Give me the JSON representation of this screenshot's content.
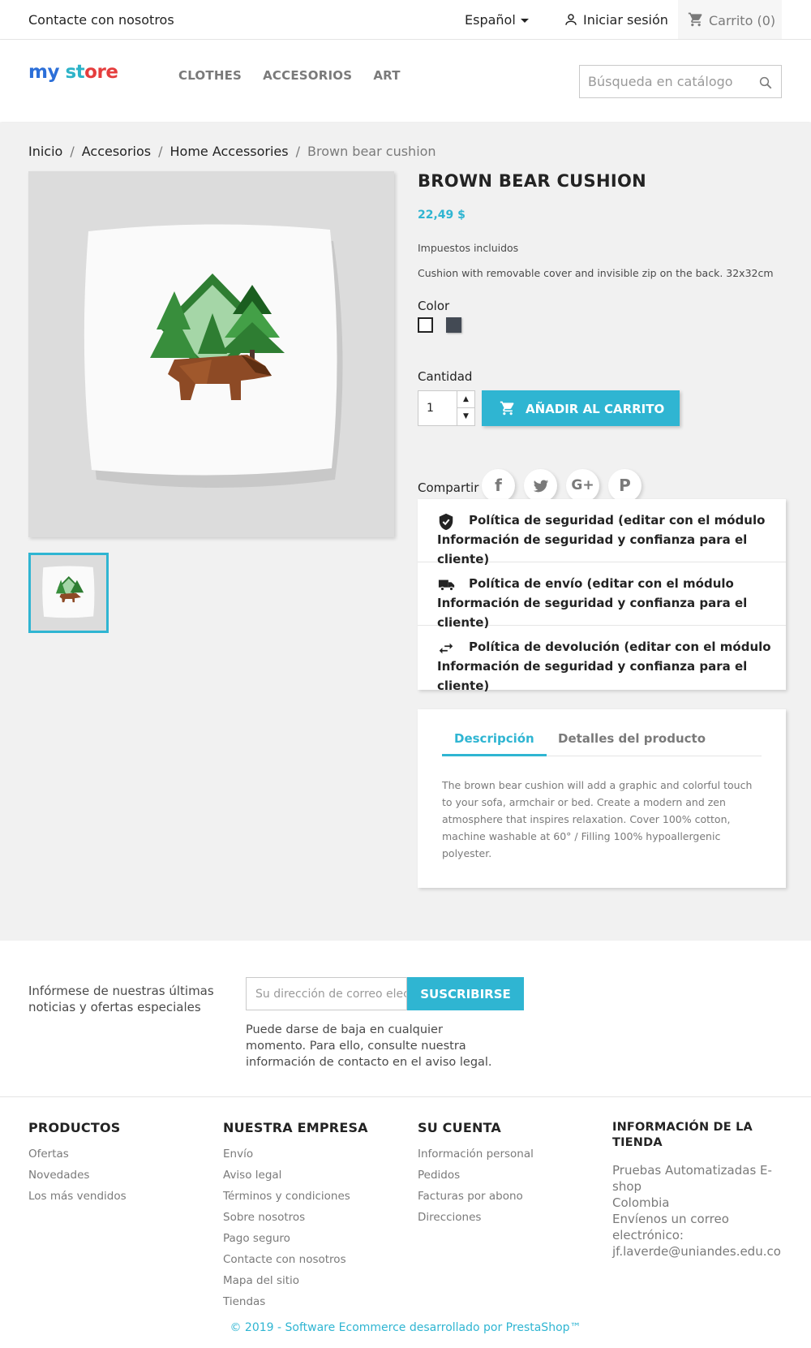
{
  "topbar": {
    "contact": "Contacte con nosotros",
    "language": "Español",
    "login": "Iniciar sesión",
    "cart": "Carrito (0)"
  },
  "header": {
    "logo_parts": [
      "my",
      " ",
      "st",
      "ore"
    ],
    "nav": [
      "CLOTHES",
      "ACCESORIOS",
      "ART"
    ],
    "search_placeholder": "Búsqueda en catálogo"
  },
  "breadcrumb": [
    "Inicio",
    "Accesorios",
    "Home Accessories",
    "Brown bear cushion"
  ],
  "product": {
    "title": "BROWN BEAR CUSHION",
    "price": "22,49 $",
    "tax": "Impuestos incluidos",
    "short_description": "Cushion with removable cover and invisible zip on the back. 32x32cm",
    "color_label": "Color",
    "colors": [
      "#ffffff",
      "#434a54"
    ],
    "quantity_label": "Cantidad",
    "quantity": "1",
    "add_to_cart": "AÑADIR AL CARRITO",
    "share_label": "Compartir"
  },
  "reassurance": [
    "Política de seguridad (editar con el módulo Información de seguridad y confianza para el cliente)",
    "Política de envío (editar con el módulo Información de seguridad y confianza para el cliente)",
    "Política de devolución (editar con el módulo Información de seguridad y confianza para el cliente)"
  ],
  "tabs": {
    "description_tab": "Descripción",
    "details_tab": "Detalles del producto",
    "description": "The brown bear cushion will add a graphic and colorful touch to your sofa, armchair or bed. Create a modern and zen atmosphere that inspires relaxation. Cover 100% cotton, machine washable at 60° / Filling 100% hypoallergenic polyester."
  },
  "newsletter": {
    "text": "Infórmese de nuestras últimas noticias y ofertas especiales",
    "placeholder": "Su dirección de correo electrónico",
    "button": "SUSCRIBIRSE",
    "note": "Puede darse de baja en cualquier momento. Para ello, consulte nuestra información de contacto en el aviso legal."
  },
  "footer": {
    "products_title": "PRODUCTOS",
    "products": [
      "Ofertas",
      "Novedades",
      "Los más vendidos"
    ],
    "company_title": "NUESTRA EMPRESA",
    "company": [
      "Envío",
      "Aviso legal",
      "Términos y condiciones",
      "Sobre nosotros",
      "Pago seguro",
      "Contacte con nosotros",
      "Mapa del sitio",
      "Tiendas"
    ],
    "account_title": "SU CUENTA",
    "account": [
      "Información personal",
      "Pedidos",
      "Facturas por abono",
      "Direcciones"
    ],
    "store_title": "INFORMACIÓN DE LA TIENDA",
    "store_lines": [
      "Pruebas Automatizadas E-shop",
      "Colombia",
      "Envíenos un correo electrónico:",
      "jf.laverde@uniandes.edu.co"
    ],
    "copyright": "© 2019 - Software Ecommerce desarrollado por PrestaShop™"
  }
}
